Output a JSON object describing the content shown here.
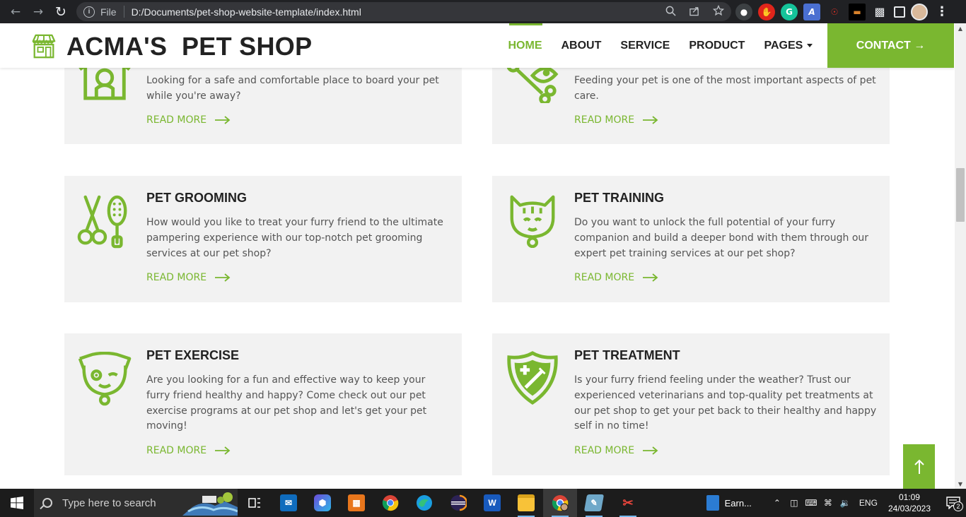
{
  "browser": {
    "scheme_label": "File",
    "url": "D:/Documents/pet-shop-website-template/index.html"
  },
  "site": {
    "brand": "ACMA'S  PET SHOP",
    "accent_color": "#7ab730",
    "nav": [
      {
        "label": "HOME",
        "active": true
      },
      {
        "label": "ABOUT",
        "active": false
      },
      {
        "label": "SERVICE",
        "active": false
      },
      {
        "label": "PRODUCT",
        "active": false
      },
      {
        "label": "PAGES",
        "active": false,
        "dropdown": true
      }
    ],
    "contact_label": "CONTACT →"
  },
  "services": [
    {
      "icon": "pet-house-icon",
      "title": "",
      "text": "Looking for a safe and comfortable place to board your pet while you're away?",
      "read_more": "READ MORE"
    },
    {
      "icon": "pet-food-icon",
      "title": "",
      "text": "Feeding your pet is one of the most important aspects of pet care.",
      "read_more": "READ MORE"
    },
    {
      "icon": "grooming-scissors-brush-icon",
      "title": "PET GROOMING",
      "text": "How would you like to treat your furry friend to the ultimate pampering experience with our top-notch pet grooming services at our pet shop?",
      "read_more": "READ MORE"
    },
    {
      "icon": "cat-face-icon",
      "title": "PET TRAINING",
      "text": "Do you want to unlock the full potential of your furry companion and build a deeper bond with them through our expert pet training services at our pet shop?",
      "read_more": "READ MORE"
    },
    {
      "icon": "dog-face-icon",
      "title": "PET EXERCISE",
      "text": "Are you looking for a fun and effective way to keep your furry friend healthy and happy? Come check out our pet exercise programs at our pet shop and let's get your pet moving!",
      "read_more": "READ MORE"
    },
    {
      "icon": "medical-shield-icon",
      "title": "PET TREATMENT",
      "text": "Is your furry friend feeling under the weather? Trust our experienced veterinarians and top-quality pet treatments at our pet shop to get your pet back to their healthy and happy self in no time!",
      "read_more": "READ MORE"
    }
  ],
  "taskbar": {
    "search_placeholder": "Type here to search",
    "pinned_doc_label": "Earn...",
    "language": "ENG",
    "time": "01:09",
    "date": "24/03/2023",
    "notification_count": "2"
  }
}
